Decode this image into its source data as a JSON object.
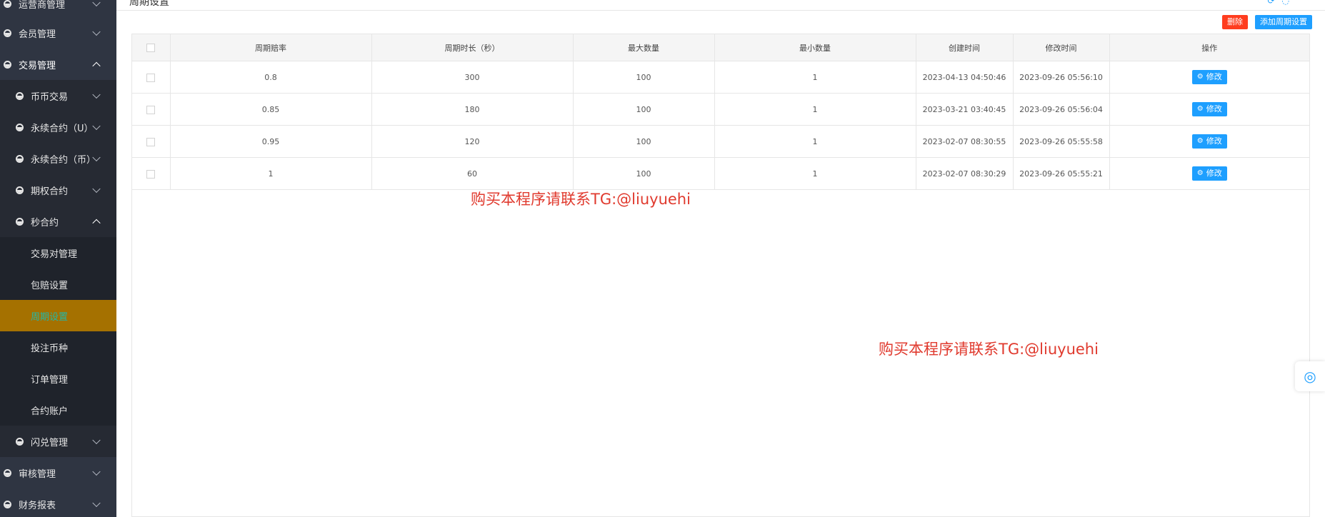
{
  "sidebar": {
    "items": [
      {
        "label": "运营商管理",
        "icon": "half-circle-icon",
        "expanded": false
      },
      {
        "label": "会员管理",
        "icon": "half-circle-icon",
        "expanded": false
      },
      {
        "label": "交易管理",
        "icon": "half-circle-icon",
        "expanded": true
      },
      {
        "label": "币币交易",
        "icon": "half-circle-icon",
        "expanded": false
      },
      {
        "label": "永续合约（U）",
        "icon": "half-circle-icon",
        "expanded": false
      },
      {
        "label": "永续合约（币）",
        "icon": "half-circle-icon",
        "expanded": false
      },
      {
        "label": "期权合约",
        "icon": "half-circle-icon",
        "expanded": false
      },
      {
        "label": "秒合约",
        "icon": "half-circle-icon",
        "expanded": true
      },
      {
        "label": "交易对管理"
      },
      {
        "label": "包赔设置"
      },
      {
        "label": "周期设置",
        "selected": true
      },
      {
        "label": "投注币种"
      },
      {
        "label": "订单管理"
      },
      {
        "label": "合约账户"
      },
      {
        "label": "闪兑管理",
        "icon": "half-circle-icon",
        "expanded": false
      },
      {
        "label": "审核管理",
        "icon": "half-circle-icon",
        "expanded": false
      },
      {
        "label": "财务报表",
        "icon": "half-circle-icon",
        "expanded": false
      }
    ]
  },
  "header": {
    "breadcrumb": "周期设置"
  },
  "toolbar": {
    "delete_label": "删除",
    "add_label": "添加周期设置"
  },
  "table": {
    "headers": [
      "周期赔率",
      "周期时长（秒）",
      "最大数量",
      "最小数量",
      "创建时间",
      "修改时间",
      "操作"
    ],
    "rows": [
      {
        "rate": "0.8",
        "duration": "300",
        "max": "100",
        "min": "1",
        "created": "2023-04-13 04:50:46",
        "modified": "2023-09-26 05:56:10"
      },
      {
        "rate": "0.85",
        "duration": "180",
        "max": "100",
        "min": "1",
        "created": "2023-03-21 03:40:45",
        "modified": "2023-09-26 05:56:04"
      },
      {
        "rate": "0.95",
        "duration": "120",
        "max": "100",
        "min": "1",
        "created": "2023-02-07 08:30:55",
        "modified": "2023-09-26 05:55:58"
      },
      {
        "rate": "1",
        "duration": "60",
        "max": "100",
        "min": "1",
        "created": "2023-02-07 08:30:29",
        "modified": "2023-09-26 05:55:21"
      }
    ],
    "edit_label": "修改"
  },
  "watermarks": [
    "购买本程序请联系TG:@liuyuehi",
    "购买本程序请联系TG:@liuyuehi"
  ],
  "colors": {
    "sidebar_bg": "#2f3542",
    "selected_bg": "#a57100",
    "primary": "#1e9fff",
    "danger": "#ff3d1f",
    "watermark": "#e03a2e"
  }
}
